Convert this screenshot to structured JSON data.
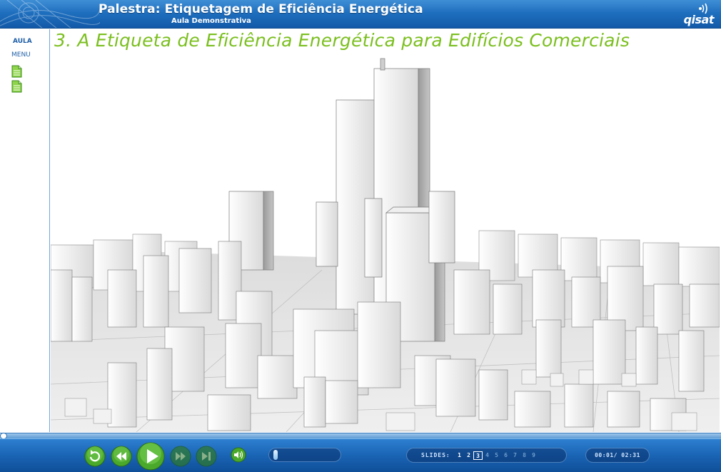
{
  "header": {
    "title": "Palestra: Etiquetagem de Eficiência Energética",
    "subtitle": "Aula Demonstrativa",
    "logo_text": "qisat"
  },
  "sidebar": {
    "aula_label": "AULA",
    "menu_label": "MENU",
    "items": [
      {
        "icon": "document-icon"
      },
      {
        "icon": "document-icon"
      }
    ]
  },
  "slide": {
    "title": "3. A Etiqueta de Eficiência Energética para Edifícios Comerciais",
    "image": "city-skyline-3d-render"
  },
  "player": {
    "progress_fraction": 0.005,
    "volume_fraction": 0.02,
    "controls": [
      "replay-icon",
      "rewind-icon",
      "play-icon",
      "fast-forward-icon",
      "skip-end-icon",
      "volume-icon"
    ],
    "slides_label": "SLIDES:",
    "slides": [
      {
        "label": "1",
        "state": "visited"
      },
      {
        "label": "2",
        "state": "visited"
      },
      {
        "label": "3",
        "state": "current"
      },
      {
        "label": "4",
        "state": "pending"
      },
      {
        "label": "5",
        "state": "pending"
      },
      {
        "label": "6",
        "state": "pending"
      },
      {
        "label": "7",
        "state": "pending"
      },
      {
        "label": "8",
        "state": "pending"
      },
      {
        "label": "9",
        "state": "pending"
      }
    ],
    "time": "00:01/ 02:31"
  },
  "colors": {
    "header_blue": "#1f6fbf",
    "title_green": "#7bbf1f",
    "control_green": "#4aa82a",
    "sidebar_text": "#1f5fa8"
  }
}
